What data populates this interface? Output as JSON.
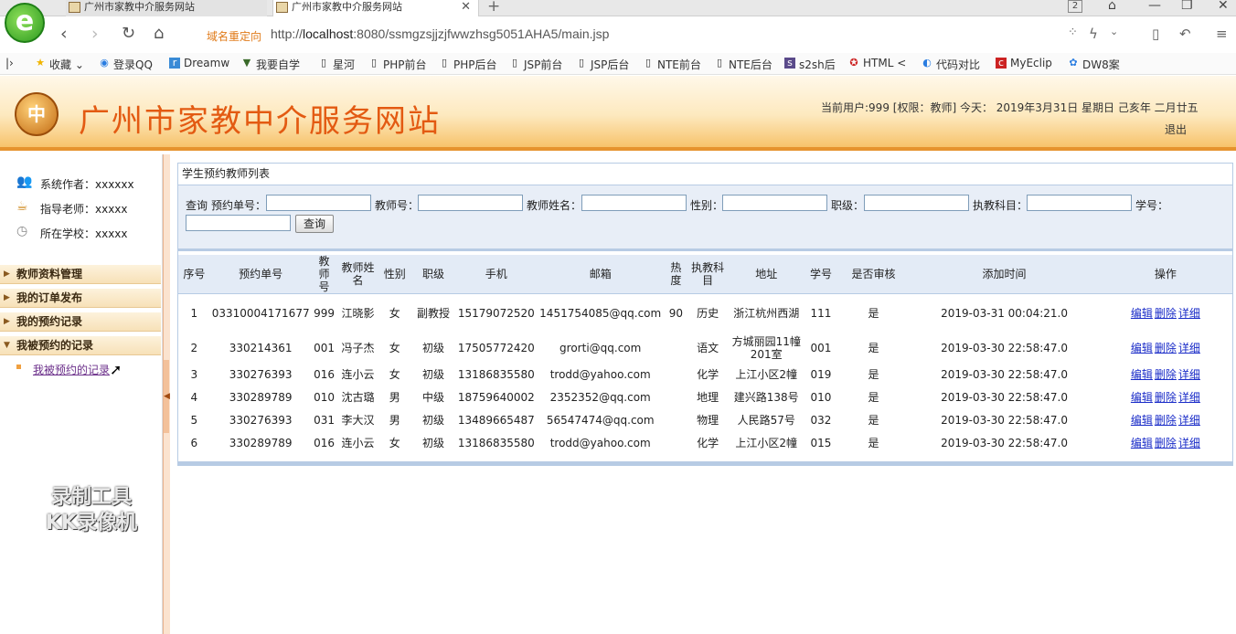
{
  "browser": {
    "tabs": [
      {
        "title": "广州市家教中介服务网站"
      },
      {
        "title": "广州市家教中介服务网站"
      }
    ],
    "tab_count": "2",
    "redirect_label": "域名重定向",
    "url_prefix": "http://",
    "url_host": "localhost",
    "url_rest": ":8080/ssmgzsjjzjfwwzhsg5051AHA5/main.jsp",
    "bookmarks": [
      "收藏",
      "登录QQ",
      "Dreamw",
      "我要自学",
      "星河",
      "PHP前台",
      "PHP后台",
      "JSP前台",
      "JSP后台",
      "NTE前台",
      "NTE后台",
      "s2sh后",
      "HTML <",
      "代码对比",
      "MyEclip",
      "DW8案"
    ]
  },
  "header": {
    "logo_text": "中",
    "site_title": "广州市家教中介服务网站",
    "user_info": "当前用户:999 [权限：教师] 今天： 2019年3月31日 星期日 己亥年 二月廿五",
    "logout": "退出"
  },
  "sidebar": {
    "info": [
      {
        "label": "系统作者：xxxxxx"
      },
      {
        "label": "指导老师：xxxxx"
      },
      {
        "label": "所在学校：xxxxx"
      }
    ],
    "menus": [
      {
        "label": "教师资料管理"
      },
      {
        "label": "我的订单发布"
      },
      {
        "label": "我的预约记录"
      },
      {
        "label": "我被预约的记录"
      }
    ],
    "active_sub": "我被预约的记录",
    "watermark_line1": "录制工具",
    "watermark_line2": "KK录像机"
  },
  "content": {
    "title": "学生预约教师列表",
    "search": {
      "prefix": "查询",
      "labels": [
        "预约单号：",
        "教师号：",
        "教师姓名：",
        "性别：",
        "职级：",
        "执教科目：",
        "学号："
      ],
      "button": "查询"
    },
    "columns": [
      "序号",
      "预约单号",
      "教师号",
      "教师姓名",
      "性别",
      "职级",
      "手机",
      "邮箱",
      "热度",
      "执教科目",
      "地址",
      "学号",
      "是否审核",
      "添加时间",
      "操作"
    ],
    "action_labels": {
      "edit": "编辑",
      "delete": "删除",
      "detail": "详细"
    },
    "rows": [
      {
        "no": "1",
        "order": "03310004171677",
        "tid": "999",
        "tname": "江晓影",
        "sex": "女",
        "level": "副教授",
        "phone": "15179072520",
        "email": "1451754085@qq.com",
        "heat": "90",
        "subject": "历史",
        "addr": "浙江杭州西湖",
        "sid": "111",
        "audit": "是",
        "time": "2019-03-31 00:04:21.0"
      },
      {
        "no": "2",
        "order": "330214361",
        "tid": "001",
        "tname": "冯子杰",
        "sex": "女",
        "level": "初级",
        "phone": "17505772420",
        "email": "grorti@qq.com",
        "heat": "",
        "subject": "语文",
        "addr": "方城丽园11幢201室",
        "sid": "001",
        "audit": "是",
        "time": "2019-03-30 22:58:47.0"
      },
      {
        "no": "3",
        "order": "330276393",
        "tid": "016",
        "tname": "连小云",
        "sex": "女",
        "level": "初级",
        "phone": "13186835580",
        "email": "trodd@yahoo.com",
        "heat": "",
        "subject": "化学",
        "addr": "上江小区2幢",
        "sid": "019",
        "audit": "是",
        "time": "2019-03-30 22:58:47.0"
      },
      {
        "no": "4",
        "order": "330289789",
        "tid": "010",
        "tname": "沈古璐",
        "sex": "男",
        "level": "中级",
        "phone": "18759640002",
        "email": "2352352@qq.com",
        "heat": "",
        "subject": "地理",
        "addr": "建兴路138号",
        "sid": "010",
        "audit": "是",
        "time": "2019-03-30 22:58:47.0"
      },
      {
        "no": "5",
        "order": "330276393",
        "tid": "031",
        "tname": "李大汉",
        "sex": "男",
        "level": "初级",
        "phone": "13489665487",
        "email": "56547474@qq.com",
        "heat": "",
        "subject": "物理",
        "addr": "人民路57号",
        "sid": "032",
        "audit": "是",
        "time": "2019-03-30 22:58:47.0"
      },
      {
        "no": "6",
        "order": "330289789",
        "tid": "016",
        "tname": "连小云",
        "sex": "女",
        "level": "初级",
        "phone": "13186835580",
        "email": "trodd@yahoo.com",
        "heat": "",
        "subject": "化学",
        "addr": "上江小区2幢",
        "sid": "015",
        "audit": "是",
        "time": "2019-03-30 22:58:47.0"
      }
    ]
  },
  "colors": {
    "accent": "#e35a12",
    "header_border": "#e6932e",
    "link": "#1a2cc8",
    "grid_border": "#b7cbe4"
  }
}
